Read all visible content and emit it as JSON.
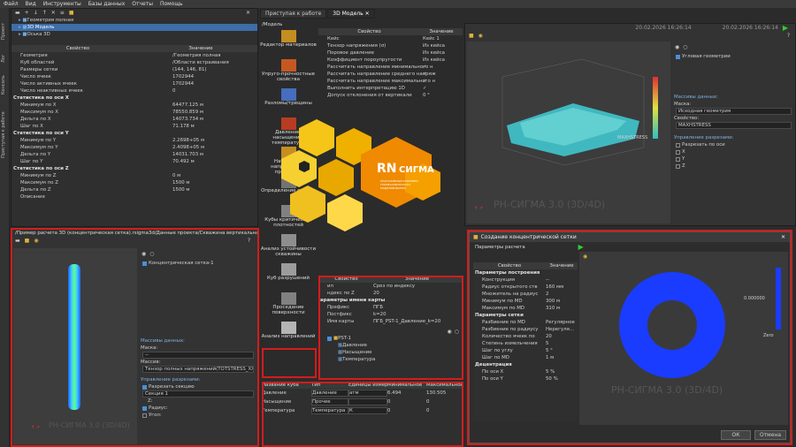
{
  "menu": [
    "Файл",
    "Вид",
    "Инструменты",
    "Базы данных",
    "Отчеты",
    "Помощь"
  ],
  "left_tabs": [
    "Проект",
    "Лог",
    "Консоль",
    "Приступая к работе"
  ],
  "project_tree": [
    {
      "label": "Геометрия полная"
    },
    {
      "label": "3D Модель",
      "selected": true
    },
    {
      "label": "Оська 3D"
    }
  ],
  "props_header": {
    "prop": "Свойство",
    "val": "Значение"
  },
  "props": [
    {
      "k": "Геометрия",
      "v": "/Геометрия полная"
    },
    {
      "k": "Куб областей",
      "v": "/Области встраивания"
    },
    {
      "k": "Размеры сетки",
      "v": "(144, 146, 81)"
    },
    {
      "k": "Число ячеек",
      "v": "1702944"
    },
    {
      "k": "Число активных ячеек",
      "v": "1702944"
    },
    {
      "k": "Число неактивных ячеек",
      "v": "0"
    },
    {
      "k": "Статистика по оси X",
      "v": "",
      "s": true
    },
    {
      "k": "Минимум по X",
      "v": "64477.125 м"
    },
    {
      "k": "Максимум по X",
      "v": "78550.859 м"
    },
    {
      "k": "Дельта по X",
      "v": "14073.734 м"
    },
    {
      "k": "Шаг по X",
      "v": "71.178 м"
    },
    {
      "k": "Статистика по оси Y",
      "v": "",
      "s": true
    },
    {
      "k": "Минимум по Y",
      "v": "2.2698+05 м"
    },
    {
      "k": "Максимум по Y",
      "v": "2.4098+05 м"
    },
    {
      "k": "Дельта по Y",
      "v": "14031.703 м"
    },
    {
      "k": "Шаг по Y",
      "v": "70.492 м"
    },
    {
      "k": "Статистика по оси Z",
      "v": "",
      "s": true
    },
    {
      "k": "Минимум по Z",
      "v": "0 м"
    },
    {
      "k": "Максимум по Z",
      "v": "1500 м"
    },
    {
      "k": "Дельта по Z",
      "v": "1500 м"
    },
    {
      "k": "Описание",
      "v": ""
    }
  ],
  "doc_tabs": [
    "Приступая к работе",
    "3D Модель"
  ],
  "breadcrumb": "/Модель",
  "tools": [
    "Редактор материалов",
    "Упруго-прочностные свойства",
    "Разломы/трещины",
    "Давление, насыщение, температура",
    "Начальные напряжения / прочности",
    "Определение границ",
    "Кубы критических плотностей",
    "Анализ устойчивости скважины",
    "Куб разрушений",
    "Проседание поверхности",
    "Анализ направлений"
  ],
  "center_props": [
    {
      "k": "Кейс",
      "v": "Кейс 1"
    },
    {
      "k": "Тензор напряжения (σ)",
      "v": "Из кейса"
    },
    {
      "k": "Поровое давление",
      "v": "Из кейса"
    },
    {
      "k": "Коэффициент пороупругости",
      "v": "Из кейса"
    },
    {
      "k": "Рассчитать направление минимального н",
      "v": "✓"
    },
    {
      "k": "Рассчитать направление среднего напряж",
      "v": "✓"
    },
    {
      "k": "Рассчитать направление максимального н",
      "v": "✓"
    },
    {
      "k": "Выполнить интерпретацию 1D",
      "v": "✓"
    },
    {
      "k": "Допуск отклонения от вертикали",
      "v": "0 °"
    }
  ],
  "slice_props": [
    {
      "k": "ип",
      "v": "Срез по индексу"
    },
    {
      "k": "ндекс по Z",
      "v": "20"
    },
    {
      "k": "араметры имени карты",
      "v": "",
      "s": true
    },
    {
      "k": "Префикс",
      "v": "ПГБ"
    },
    {
      "k": "Постфикс",
      "v": "k=20"
    },
    {
      "k": "Имя карты",
      "v": "ПГБ_PST-1_Давление_k=20"
    }
  ],
  "pst_tree": {
    "root": "PST-1",
    "items": [
      "Давление",
      "Насыщение",
      "Температура"
    ]
  },
  "cube_table": {
    "headers": [
      "Название куба",
      "Тип",
      "Единицы измерени",
      "Минимальное",
      "Максимальное"
    ],
    "rows": [
      {
        "name": "Давление",
        "type": "Давление",
        "unit": "атм",
        "min": "6.494",
        "max": "130.505"
      },
      {
        "name": "Насыщение",
        "type": "Прочее",
        "unit": "",
        "min": "0",
        "max": "0"
      },
      {
        "name": "Температура",
        "type": "Температура",
        "unit": "К",
        "min": "0",
        "max": "0"
      }
    ]
  },
  "view3d": {
    "date1": "20.02.2026 16:26:14",
    "date2": "20.02.2026 16:26:14",
    "prop_label": "MAXHSTRESS",
    "watermark": "РН-СИГМА 3.0 (3D/4D)",
    "axis_label": "Z Y X"
  },
  "right_props": {
    "tree_item": "Угловая геометрии",
    "mass_title": "Массивы данных:",
    "mask_label": "Маска:",
    "mask_val": "Исходная геометрия",
    "prop_label": "Свойство:",
    "prop_val": "MAXHSTRESS",
    "cut_title": "Управление разрезами:",
    "cut_check": "Разрезать по оси",
    "axes": [
      "X",
      "Y",
      "Z"
    ]
  },
  "concentric_window": {
    "path": "/Пример расчета 3D (концентрическая сетка).rsigma3d/Данные проекта/Скважина вертикальная/...",
    "tree_item": "Концентрическая сетка-1",
    "mass_title": "Массивы данных:",
    "mask_label": "Маска:",
    "mask_val": "--",
    "prop_label": "Массив:",
    "prop_val": "Тензор полных напряжений(TOTSTRESS_XX",
    "cut_title": "Управление разрезами:",
    "cut_check": "Разрезать секцию",
    "section": "Секция 1",
    "z_label": "Z:",
    "radius_label": "Радиус:",
    "angle_label": "Угол:",
    "watermark": "РН-СИГМА 3.0 (3D/4D)"
  },
  "dialog": {
    "title": "Создание концентрической сетки",
    "subtitle": "Параметры расчета",
    "headers": {
      "prop": "Свойство",
      "val": "Значение"
    },
    "rows": [
      {
        "k": "Параметры построения",
        "v": "",
        "s": true
      },
      {
        "k": "Конструкция",
        "v": "--"
      },
      {
        "k": "Радиус открытого ств",
        "v": "160 мм"
      },
      {
        "k": "Множитель на радиус",
        "v": "2"
      },
      {
        "k": "Минимум по MD",
        "v": "300 м"
      },
      {
        "k": "Максимум по MD",
        "v": "310 м"
      },
      {
        "k": "Параметры сетки",
        "v": "",
        "s": true
      },
      {
        "k": "Разбиение по MD",
        "v": "Регулярное"
      },
      {
        "k": "Разбиение по радиусу",
        "v": "Нерегуля..."
      },
      {
        "k": "Количество ячеек по",
        "v": "20"
      },
      {
        "k": "Степень измельчения",
        "v": "5"
      },
      {
        "k": "Шаг по углу",
        "v": "5 °"
      },
      {
        "k": "Шаг по MD",
        "v": "1 м"
      },
      {
        "k": "Децентрация",
        "v": "",
        "s": true
      },
      {
        "k": "По оси X",
        "v": "5 %"
      },
      {
        "k": "По оси Y",
        "v": "50 %"
      }
    ],
    "ok": "ОК",
    "cancel": "Отмена",
    "colorbar_label": "0.000000",
    "zero_label": "Zero",
    "watermark": "РН-СИГМА 3.0 (3D/4D)"
  },
  "logo": {
    "text": "RN",
    "text2": "СИГМА",
    "sub": "ПРОГРАММНЫЙ КОМПЛЕКС ГЕОМЕХАНИЧЕСКОГО МОДЕЛИРОВАНИЯ"
  },
  "colors": {
    "accent": "#f0a000",
    "red": "#d41c1c",
    "blue": "#1a3cff",
    "teal": "#3fc0c0"
  }
}
